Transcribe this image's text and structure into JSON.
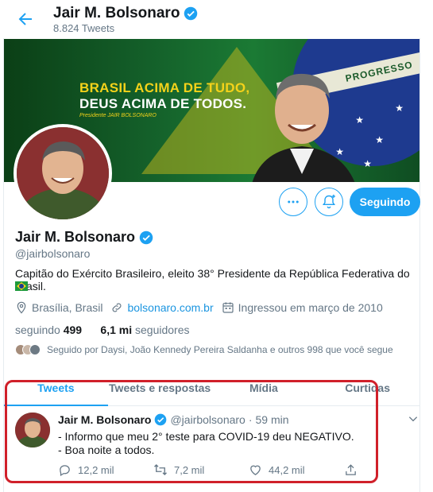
{
  "header": {
    "title": "Jair M. Bolsonaro",
    "tweet_count": "8.824 Tweets"
  },
  "banner": {
    "slogan_line1": "BRASIL ACIMA DE TUDO,",
    "slogan_line2": "DEUS ACIMA DE TODOS.",
    "signature": "Presidente JAIR BOLSONARO",
    "flag_band_text": "PROGRESSO"
  },
  "profile": {
    "name": "Jair M. Bolsonaro",
    "handle": "@jairbolsonaro",
    "bio": "Capitão do Exército Brasileiro, eleito 38° Presidente da República Federativa do Brasil.",
    "location": "Brasília, Brasil",
    "website": "bolsonaro.com.br",
    "joined": "Ingressou em março de 2010",
    "following_label": "seguindo",
    "following_count": "499",
    "followers_count": "6,1 mi",
    "followers_label": "seguidores",
    "followed_by": "Seguido por Daysi, João Kennedy Pereira Saldanha e outros 998 que você segue"
  },
  "actions": {
    "follow_label": "Seguindo",
    "more_icon": "more-icon",
    "bell_icon": "bell-plus-icon"
  },
  "tabs": [
    {
      "label": "Tweets",
      "active": true
    },
    {
      "label": "Tweets e respostas",
      "active": false
    },
    {
      "label": "Mídia",
      "active": false
    },
    {
      "label": "Curtidas",
      "active": false
    }
  ],
  "tweet": {
    "name": "Jair M. Bolsonaro",
    "handle": "@jairbolsonaro",
    "separator": "·",
    "time": "59 min",
    "line1": "- Informo que meu 2° teste para COVID-19 deu NEGATIVO.",
    "line2": "- Boa noite a todos.",
    "replies": "12,2 mil",
    "retweets": "7,2 mil",
    "likes": "44,2 mil"
  },
  "colors": {
    "accent": "#1da1f2",
    "highlight_border": "#d0202a",
    "verified": "#1da1f2"
  }
}
